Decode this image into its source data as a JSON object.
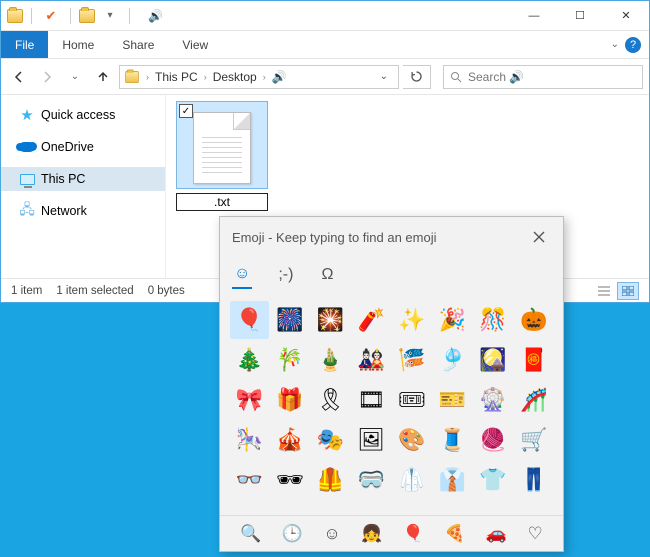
{
  "titlebar": {
    "sound_glyph": "🔊"
  },
  "window_controls": {
    "minimize": "—",
    "maximize": "☐",
    "close": "✕"
  },
  "ribbon": {
    "file": "File",
    "tabs": [
      "Home",
      "Share",
      "View"
    ],
    "help": "?"
  },
  "breadcrumb": {
    "items": [
      "This PC",
      "Desktop",
      "🔊"
    ]
  },
  "search": {
    "placeholder": "Search 🔊"
  },
  "sidebar": {
    "items": [
      {
        "label": "Quick access",
        "icon": "star"
      },
      {
        "label": "OneDrive",
        "icon": "onedrive"
      },
      {
        "label": "This PC",
        "icon": "pc",
        "selected": true
      },
      {
        "label": "Network",
        "icon": "network"
      }
    ]
  },
  "file": {
    "name": ".txt",
    "checked": true
  },
  "status": {
    "count": "1 item",
    "selected": "1 item selected",
    "size": "0 bytes"
  },
  "emoji": {
    "title": "Emoji - Keep typing to find an emoji",
    "tabs": {
      "emoji": "☺",
      "kaomoji": ";-)",
      "symbols": "Ω"
    },
    "grid": [
      "🎈",
      "🎆",
      "🎇",
      "🧨",
      "✨",
      "🎉",
      "🎊",
      "🎃",
      "🎄",
      "🎋",
      "🎍",
      "🎎",
      "🎏",
      "🎐",
      "🎑",
      "🧧",
      "🎀",
      "🎁",
      "🎗",
      "🎞",
      "🎟",
      "🎫",
      "🎡",
      "🎢",
      "🎠",
      "🎪",
      "🎭",
      "🖼",
      "🎨",
      "🧵",
      "🧶",
      "🛒",
      "👓",
      "🕶",
      "🦺",
      "🥽",
      "🥼",
      "👔",
      "👕",
      "👖"
    ],
    "selected_index": 0,
    "categories": [
      "🔍",
      "🕒",
      "☺",
      "👧",
      "🎈",
      "🍕",
      "🚗",
      "♡"
    ],
    "selected_category": 4
  }
}
